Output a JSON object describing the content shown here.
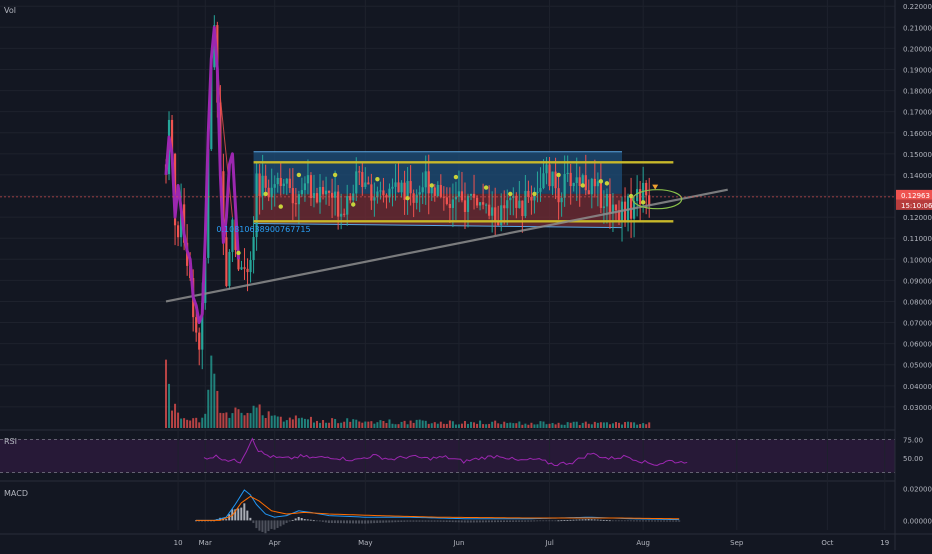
{
  "chart_data": {
    "type": "candlestick",
    "panes": {
      "main": {
        "label": "Vol"
      },
      "rsi": {
        "label": "RSI",
        "ticks": [
          "75.00",
          "50.00"
        ],
        "ylim": [
          20,
          85
        ]
      },
      "macd": {
        "label": "MACD",
        "ticks": [
          "0.02000",
          "0.00000"
        ],
        "ylim": [
          -0.006,
          0.024
        ]
      }
    },
    "price_axis": {
      "ylim": [
        0.02,
        0.222
      ],
      "ticks": [
        "0.22000",
        "0.21000",
        "0.20000",
        "0.19000",
        "0.18000",
        "0.17000",
        "0.16000",
        "0.15000",
        "0.14000",
        "0.13000",
        "0.12000",
        "0.11000",
        "0.10000",
        "0.09000",
        "0.08000",
        "0.07000",
        "0.06000",
        "0.05000",
        "0.04000",
        "0.03000"
      ],
      "last_price_label": "0.12963",
      "countdown_label": "15:10:06",
      "last_price": 0.1296
    },
    "time_axis": {
      "ticks": [
        {
          "label": "10",
          "t": 4
        },
        {
          "label": "Mar",
          "t": 13
        },
        {
          "label": "Apr",
          "t": 36
        },
        {
          "label": "May",
          "t": 66
        },
        {
          "label": "Jun",
          "t": 97
        },
        {
          "label": "Jul",
          "t": 127
        },
        {
          "label": "Aug",
          "t": 158
        },
        {
          "label": "Sep",
          "t": 189
        },
        {
          "label": "Oct",
          "t": 219
        },
        {
          "label": "19",
          "t": 238
        }
      ],
      "tlim": [
        -2,
        250
      ]
    },
    "price_keys": [
      [
        0,
        0.145
      ],
      [
        1,
        0.165
      ],
      [
        2,
        0.15
      ],
      [
        3,
        0.12
      ],
      [
        4,
        0.105
      ],
      [
        5,
        0.13
      ],
      [
        6,
        0.112
      ],
      [
        7,
        0.1
      ],
      [
        8,
        0.088
      ],
      [
        9,
        0.078
      ],
      [
        10,
        0.066
      ],
      [
        11,
        0.06
      ],
      [
        12,
        0.075
      ],
      [
        13,
        0.1
      ],
      [
        14,
        0.15
      ],
      [
        15,
        0.19
      ],
      [
        16,
        0.21
      ],
      [
        17,
        0.18
      ],
      [
        18,
        0.145
      ],
      [
        19,
        0.11
      ],
      [
        20,
        0.09
      ],
      [
        21,
        0.1
      ],
      [
        22,
        0.12
      ],
      [
        23,
        0.105
      ],
      [
        24,
        0.098
      ],
      [
        25,
        0.1
      ],
      [
        26,
        0.095
      ],
      [
        27,
        0.092
      ],
      [
        28,
        0.095
      ],
      [
        29,
        0.11
      ],
      [
        30,
        0.135
      ],
      [
        31,
        0.13
      ],
      [
        32,
        0.14
      ],
      [
        34,
        0.135
      ],
      [
        38,
        0.14
      ],
      [
        42,
        0.128
      ],
      [
        46,
        0.138
      ],
      [
        50,
        0.13
      ],
      [
        54,
        0.132
      ],
      [
        58,
        0.124
      ],
      [
        62,
        0.136
      ],
      [
        66,
        0.14
      ],
      [
        70,
        0.127
      ],
      [
        74,
        0.132
      ],
      [
        78,
        0.135
      ],
      [
        82,
        0.13
      ],
      [
        86,
        0.138
      ],
      [
        90,
        0.133
      ],
      [
        94,
        0.128
      ],
      [
        98,
        0.126
      ],
      [
        102,
        0.13
      ],
      [
        106,
        0.122
      ],
      [
        110,
        0.12
      ],
      [
        114,
        0.125
      ],
      [
        118,
        0.125
      ],
      [
        122,
        0.133
      ],
      [
        126,
        0.14
      ],
      [
        130,
        0.132
      ],
      [
        134,
        0.138
      ],
      [
        138,
        0.138
      ],
      [
        142,
        0.132
      ],
      [
        146,
        0.128
      ],
      [
        150,
        0.123
      ],
      [
        154,
        0.125
      ],
      [
        156,
        0.13
      ],
      [
        158,
        0.131
      ],
      [
        160,
        0.1296
      ]
    ],
    "volume_keys": [
      [
        0,
        0.85
      ],
      [
        1,
        0.45
      ],
      [
        2,
        0.3
      ],
      [
        3,
        0.22
      ],
      [
        5,
        0.15
      ],
      [
        8,
        0.12
      ],
      [
        10,
        0.1
      ],
      [
        12,
        0.1
      ],
      [
        13,
        0.2
      ],
      [
        14,
        0.35
      ],
      [
        15,
        0.65
      ],
      [
        16,
        0.55
      ],
      [
        17,
        0.4
      ],
      [
        18,
        0.3
      ],
      [
        20,
        0.22
      ],
      [
        24,
        0.18
      ],
      [
        28,
        0.16
      ],
      [
        30,
        0.28
      ],
      [
        32,
        0.22
      ],
      [
        36,
        0.15
      ],
      [
        40,
        0.12
      ],
      [
        50,
        0.1
      ],
      [
        70,
        0.08
      ],
      [
        100,
        0.07
      ],
      [
        130,
        0.06
      ],
      [
        160,
        0.06
      ]
    ],
    "rsi_keys": [
      [
        0,
        50
      ],
      [
        4,
        52
      ],
      [
        8,
        47
      ],
      [
        12,
        45
      ],
      [
        14,
        60
      ],
      [
        16,
        77
      ],
      [
        18,
        60
      ],
      [
        20,
        55
      ],
      [
        22,
        52
      ],
      [
        24,
        50
      ],
      [
        28,
        49
      ],
      [
        32,
        52
      ],
      [
        36,
        50
      ],
      [
        42,
        51
      ],
      [
        50,
        47
      ],
      [
        56,
        53
      ],
      [
        62,
        48
      ],
      [
        68,
        52
      ],
      [
        74,
        49
      ],
      [
        80,
        51
      ],
      [
        86,
        45
      ],
      [
        92,
        50
      ],
      [
        98,
        53
      ],
      [
        104,
        46
      ],
      [
        110,
        48
      ],
      [
        116,
        41
      ],
      [
        122,
        44
      ],
      [
        128,
        56
      ],
      [
        134,
        49
      ],
      [
        140,
        52
      ],
      [
        146,
        44
      ],
      [
        150,
        41
      ],
      [
        154,
        46
      ],
      [
        158,
        44
      ],
      [
        160,
        46
      ]
    ],
    "macd_keys": [
      [
        0,
        0.0
      ],
      [
        6,
        0.0
      ],
      [
        10,
        0.002
      ],
      [
        13,
        0.01
      ],
      [
        16,
        0.019
      ],
      [
        18,
        0.016
      ],
      [
        20,
        0.01
      ],
      [
        23,
        0.004
      ],
      [
        26,
        0.002
      ],
      [
        30,
        0.003
      ],
      [
        34,
        0.006
      ],
      [
        38,
        0.005
      ],
      [
        44,
        0.003
      ],
      [
        56,
        0.002
      ],
      [
        70,
        0.002
      ],
      [
        90,
        0.001
      ],
      [
        110,
        0.001
      ],
      [
        130,
        0.002
      ],
      [
        145,
        0.001
      ],
      [
        160,
        0.0005
      ]
    ],
    "signal_keys": [
      [
        0,
        0.0
      ],
      [
        8,
        0.0
      ],
      [
        12,
        0.003
      ],
      [
        15,
        0.011
      ],
      [
        18,
        0.015
      ],
      [
        21,
        0.012
      ],
      [
        25,
        0.006
      ],
      [
        30,
        0.004
      ],
      [
        36,
        0.005
      ],
      [
        44,
        0.004
      ],
      [
        60,
        0.003
      ],
      [
        80,
        0.002
      ],
      [
        110,
        0.0015
      ],
      [
        140,
        0.0015
      ],
      [
        160,
        0.001
      ]
    ],
    "drawings": {
      "channel": {
        "t1": 29,
        "t2": 151,
        "top": 0.151,
        "mid": 0.131,
        "bottom": 0.117,
        "bottom_end": 0.115
      },
      "horizontal_lines": [
        {
          "t1": 29,
          "t2": 168,
          "price": 0.146
        },
        {
          "t1": 29,
          "t2": 168,
          "price": 0.118
        }
      ],
      "trendline": {
        "t1": 0,
        "p1": 0.08,
        "t2": 186,
        "p2": 0.133
      },
      "annotation": {
        "t": 20,
        "price": 0.113,
        "text": "0.10810638900767715"
      },
      "projection": {
        "t1": 16,
        "p1": 0.205,
        "t2": 22,
        "p2": 0.12
      },
      "ellipse": {
        "t": 160,
        "price": 0.1285,
        "rt": 9,
        "rp": 0.0045
      },
      "down_marker": {
        "t": 160,
        "price": 0.134
      },
      "purple_curve": [
        [
          0,
          0.14
        ],
        [
          1,
          0.158
        ],
        [
          2,
          0.15
        ],
        [
          3,
          0.12
        ],
        [
          4,
          0.135
        ],
        [
          5,
          0.124
        ],
        [
          6,
          0.112
        ],
        [
          7,
          0.104
        ],
        [
          8,
          0.1
        ],
        [
          9,
          0.082
        ],
        [
          10,
          0.078
        ],
        [
          11,
          0.07
        ],
        [
          12,
          0.074
        ],
        [
          13,
          0.11
        ],
        [
          14,
          0.16
        ],
        [
          15,
          0.195
        ],
        [
          16,
          0.21
        ],
        [
          17,
          0.19
        ],
        [
          18,
          0.14
        ],
        [
          19,
          0.108
        ],
        [
          20,
          0.12
        ],
        [
          21,
          0.145
        ],
        [
          22,
          0.15
        ],
        [
          23,
          0.125
        ],
        [
          24,
          0.1
        ]
      ],
      "green_dots": [
        [
          24,
          0.103
        ],
        [
          33,
          0.131
        ],
        [
          38,
          0.125
        ],
        [
          44,
          0.14
        ],
        [
          56,
          0.14
        ],
        [
          62,
          0.126
        ],
        [
          70,
          0.138
        ],
        [
          80,
          0.129
        ],
        [
          88,
          0.135
        ],
        [
          96,
          0.139
        ],
        [
          106,
          0.134
        ],
        [
          114,
          0.131
        ],
        [
          122,
          0.131
        ],
        [
          130,
          0.14
        ],
        [
          138,
          0.135
        ],
        [
          144,
          0.137
        ],
        [
          146,
          0.136
        ],
        [
          154,
          0.13
        ],
        [
          158,
          0.127
        ]
      ]
    },
    "colors": {
      "background": "#131722",
      "up": "#26a69a",
      "down": "#ef5350",
      "grid": "#1e222d",
      "channel_top_fill": "#1d4f7a",
      "channel_bottom_fill": "#6e2a33",
      "horizontal_line": "#c8b82a",
      "trendline": "#8d8d8d",
      "purple_curve": "#9c27b0",
      "annotation": "#2a9ff5",
      "rsi_line": "#9c27b0",
      "rsi_band": "#2a1a3a",
      "macd_line": "#2196f3",
      "signal_line": "#ff6d00",
      "dot": "#c8d23a",
      "price_label_bg": "#ef5350",
      "countdown_bg": "#b73d3d"
    }
  }
}
